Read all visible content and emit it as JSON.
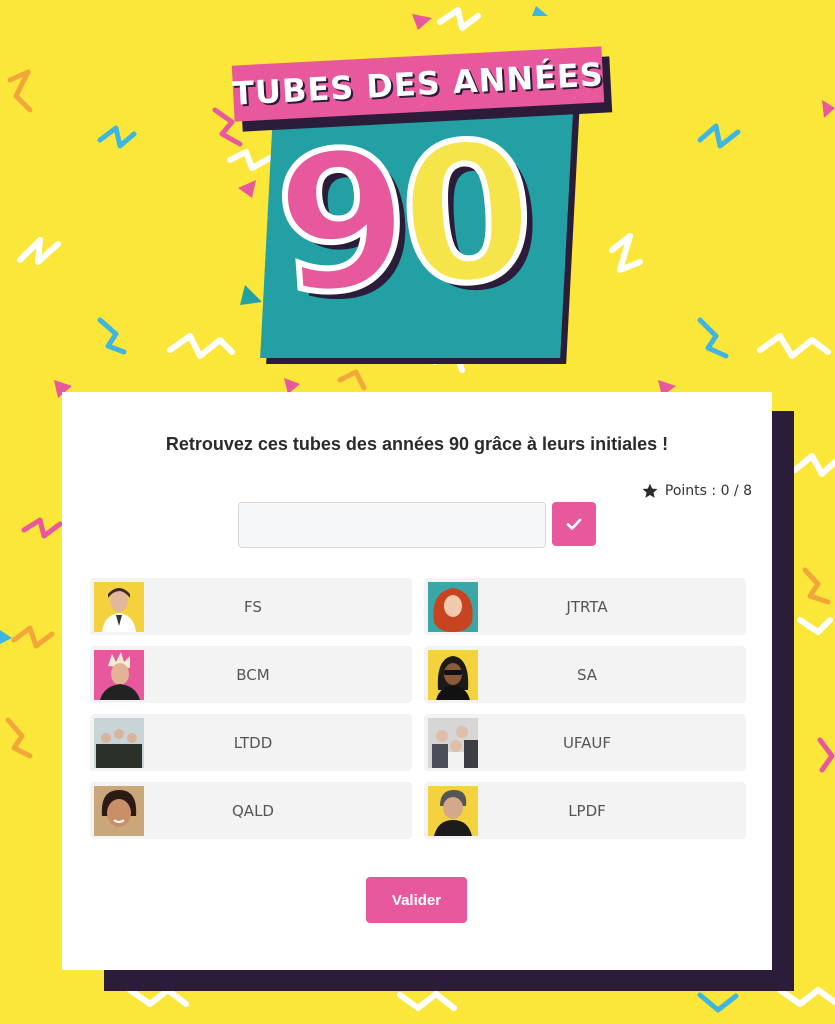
{
  "logo": {
    "banner_text": "TUBES DES ANNÉES",
    "number_first_digit": "9",
    "number_second_digit": "0"
  },
  "quiz": {
    "title": "Retrouvez ces tubes des années 90 grâce à leurs initiales !",
    "points_label": "Points : 0 / 8",
    "answer_input": {
      "value": "",
      "placeholder": ""
    },
    "submit_label": "Valider",
    "items": [
      {
        "initials": "FS",
        "photo_bg": "#f4d23e"
      },
      {
        "initials": "JTRTA",
        "photo_bg": "#3aa7a6"
      },
      {
        "initials": "BCM",
        "photo_bg": "#e8589c"
      },
      {
        "initials": "SA",
        "photo_bg": "#f4d23e"
      },
      {
        "initials": "LTDD",
        "photo_bg": "#c9d4d6"
      },
      {
        "initials": "UFAUF",
        "photo_bg": "#d6d6d6"
      },
      {
        "initials": "QALD",
        "photo_bg": "#c9a77a"
      },
      {
        "initials": "LPDF",
        "photo_bg": "#f4d23e"
      }
    ]
  },
  "colors": {
    "background": "#fbe63a",
    "accent_pink": "#e8589c",
    "accent_teal": "#22a0a3",
    "dark_shadow": "#2b1c3a"
  },
  "icons": {
    "points": "star-icon",
    "submit_answer": "check-icon"
  }
}
